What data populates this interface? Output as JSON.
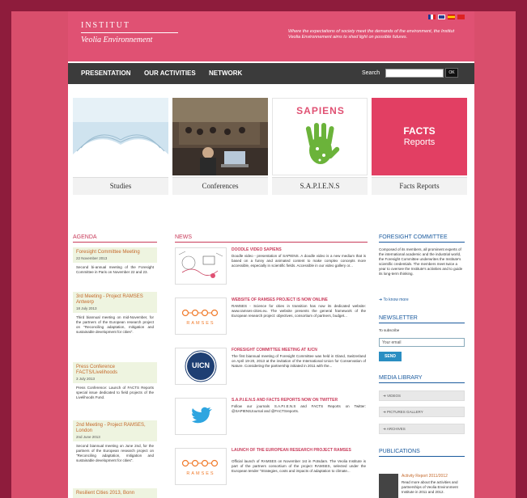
{
  "header": {
    "logo_line1": "INSTITUT",
    "logo_line2": "Veolia Environnement",
    "tagline": "Where the expectations of society meet the demands of the environment, the Institut Veolia Environnement aims to shed light on possible futures."
  },
  "nav": {
    "items": [
      {
        "label": "PRESENTATION"
      },
      {
        "label": "OUR ACTIVITIES"
      },
      {
        "label": "NETWORK"
      }
    ],
    "search_label": "Search",
    "search_button": "OK"
  },
  "tiles": [
    {
      "label": "Studies"
    },
    {
      "label": "Conferences"
    },
    {
      "label": "S.A.P.I.E.N.S",
      "image_text": "SAPIENS"
    },
    {
      "label": "Facts Reports",
      "image_text_1": "FACTS",
      "image_text_2": "Reports"
    }
  ],
  "agenda": {
    "title": "AGENDA",
    "items": [
      {
        "title": "Foresight Committee Meeting",
        "date": "22 November 2013",
        "desc": "Second bi-annual meeting of the Foresight Committee in Paris on November 22 and 23."
      },
      {
        "title": "3rd Meeting - Project RAMSES Antwerp",
        "date": "18 July 2013",
        "desc": "Third biannual meeting on mid-November, for the partners of the European research project on \"Reconciling adaptation, mitigation and sustainable development for cities\"."
      },
      {
        "title": "Press Conference FACTS/Livelihoods",
        "date": "3 July 2013",
        "desc": "Press Conference: Launch of FACTS Reports special issue dedicated to field projects of the Livelihoods Fund."
      },
      {
        "title": "2nd Meeting - Project RAMSES, London",
        "date": "2nd June 2013",
        "desc": "Second biannual meeting on June 2nd, for the partners of the European research project on \"Reconciling adaptation, mitigation and sustainable development for cities\"."
      },
      {
        "title": "Resilient Cities 2013, Bonn"
      }
    ]
  },
  "news": {
    "title": "NEWS",
    "items": [
      {
        "title": "DOODLE VIDEO SAPIENS",
        "body": "Doodle video - presentation of SAPIENS. A doodle video is a new medium that is based on a funny and animated content to make complex concepts more accessible, especially in scientific fields. Accessible in our video gallery or..."
      },
      {
        "title": "WEBSITE OF RAMSES PROJECT IS NOW ONLINE",
        "body": "RAMSES - Science for cities in transition has now its dedicated website: www.ramses-cities.eu. The website presents the general framework of the European research project: objectives, consortium of partners, budget..."
      },
      {
        "title": "FORESIGHT COMMITTEE MEETING AT IUCN",
        "body": "The first biannual meeting of Foresight Committee was held in Gland, Switzerland on April 19-20, 2013 at the invitation of the International Union for Conservation of Nature. Considering the partnership initiated in 2011 with the..."
      },
      {
        "title": "S.A.P.I.E.N.S AND FACTS REPORTS NOW ON TWITTER",
        "body": "Follow our journals S.A.P.I.E.N.S and FACTS Reports on Twitter: @SAPIENSJournal and @FACTSreports."
      },
      {
        "title": "LAUNCH OF THE EUROPEAN RESEARCH PROJECT RAMSES",
        "body": "Official launch of RAMSES on November 1st in Potsdam. The Veolia Institute is part of the partners consortium of the project RAMSES, selected under the European tender \"Strategies, costs and impacts of adaptation to climate..."
      }
    ],
    "ramses_text": "RAMSES",
    "iucn_text": "UICN"
  },
  "foresight": {
    "title": "FORESIGHT COMMITTEE",
    "text": "Composed of its members, all prominent experts of the international academic and the industrial world, the Foresight Committee underwrites the Institute's scientific credentials. The members meet twice a year to oversee the Institute's activities and to guide its long-term thinking.",
    "more": "To know more"
  },
  "newsletter": {
    "title": "NEWSLETTER",
    "label": "To subscribe",
    "value": "Your email",
    "button": "SEND"
  },
  "media": {
    "title": "MEDIA LIBRARY",
    "items": [
      {
        "label": "VIDEOS"
      },
      {
        "label": "PICTURES GALLERY"
      },
      {
        "label": "ARCHIVES"
      }
    ]
  },
  "publications": {
    "title": "PUBLICATIONS",
    "item_title": "Activity Report 2011/2012",
    "item_text": "Read more about the activities and partnerships of Veolia Environment Institute in 2011 and 2012."
  },
  "colors": {
    "accent": "#e05173",
    "nav": "#3b3b3b",
    "background": "#8e1c3c"
  }
}
